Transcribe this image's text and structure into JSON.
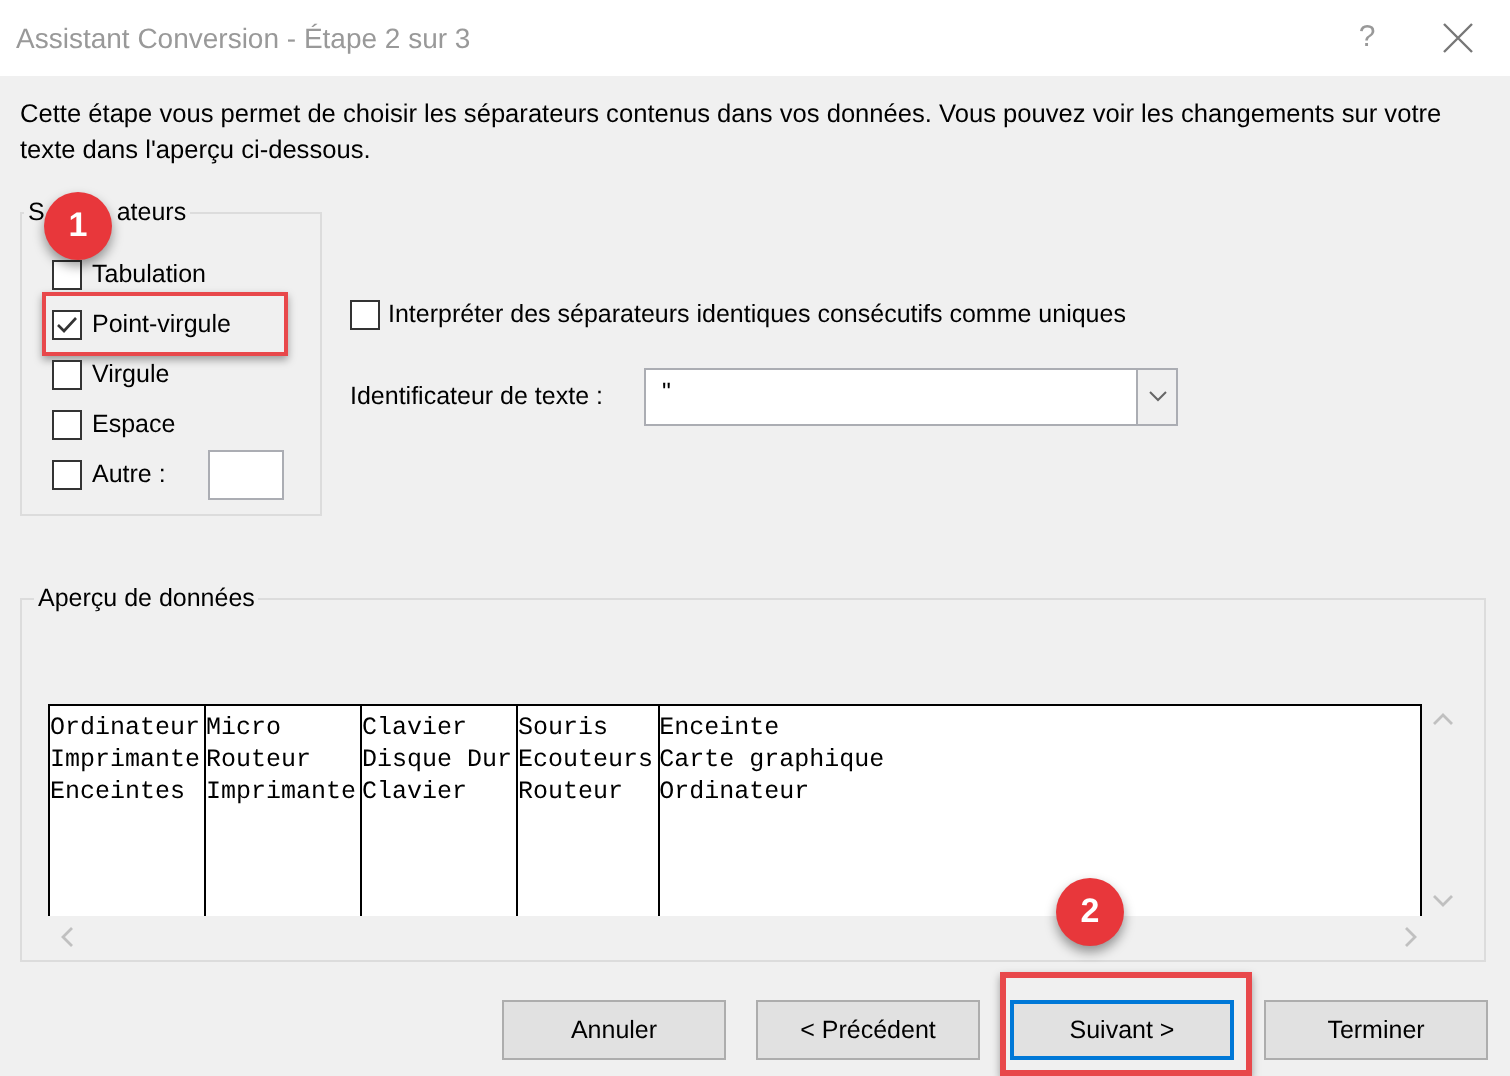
{
  "window": {
    "title": "Assistant Conversion - Étape 2 sur 3",
    "help": "?"
  },
  "description": "Cette étape vous permet de choisir les séparateurs contenus dans vos données. Vous pouvez voir les changements sur votre texte dans l'aperçu ci-dessous.",
  "separators": {
    "legend_parts": [
      "S",
      "ateurs"
    ],
    "options": [
      {
        "kind": "checkbox",
        "label": "Tabulation",
        "checked": false,
        "highlighted": false
      },
      {
        "kind": "checkbox",
        "label": "Point-virgule",
        "checked": true,
        "highlighted": true
      },
      {
        "kind": "checkbox",
        "label": "Virgule",
        "checked": false,
        "highlighted": false
      },
      {
        "kind": "checkbox",
        "label": "Espace",
        "checked": false,
        "highlighted": false
      },
      {
        "kind": "other",
        "label": "Autre :",
        "checked": false,
        "highlighted": false
      }
    ]
  },
  "consecutive": {
    "label": "Interpréter des séparateurs identiques consécutifs comme uniques",
    "checked": false
  },
  "text_qualifier": {
    "label": "Identificateur de texte :",
    "value": "\""
  },
  "preview": {
    "legend": "Aperçu de données",
    "rows": [
      [
        "Ordinateur",
        "Micro",
        "Clavier",
        "Souris",
        "Enceinte"
      ],
      [
        "Imprimante",
        "Routeur",
        "Disque Dur",
        "Ecouteurs",
        "Carte graphique"
      ],
      [
        "Enceintes",
        "Imprimante",
        "Clavier",
        "Routeur",
        "Ordinateur"
      ]
    ]
  },
  "buttons": [
    {
      "label": "Annuler",
      "default": false,
      "highlighted": false
    },
    {
      "label": "< Précédent",
      "default": false,
      "highlighted": false
    },
    {
      "label": "Suivant >",
      "default": true,
      "highlighted": true
    },
    {
      "label": "Terminer",
      "default": false,
      "highlighted": false
    }
  ],
  "callouts": [
    {
      "number": "1"
    },
    {
      "number": "2"
    }
  ]
}
